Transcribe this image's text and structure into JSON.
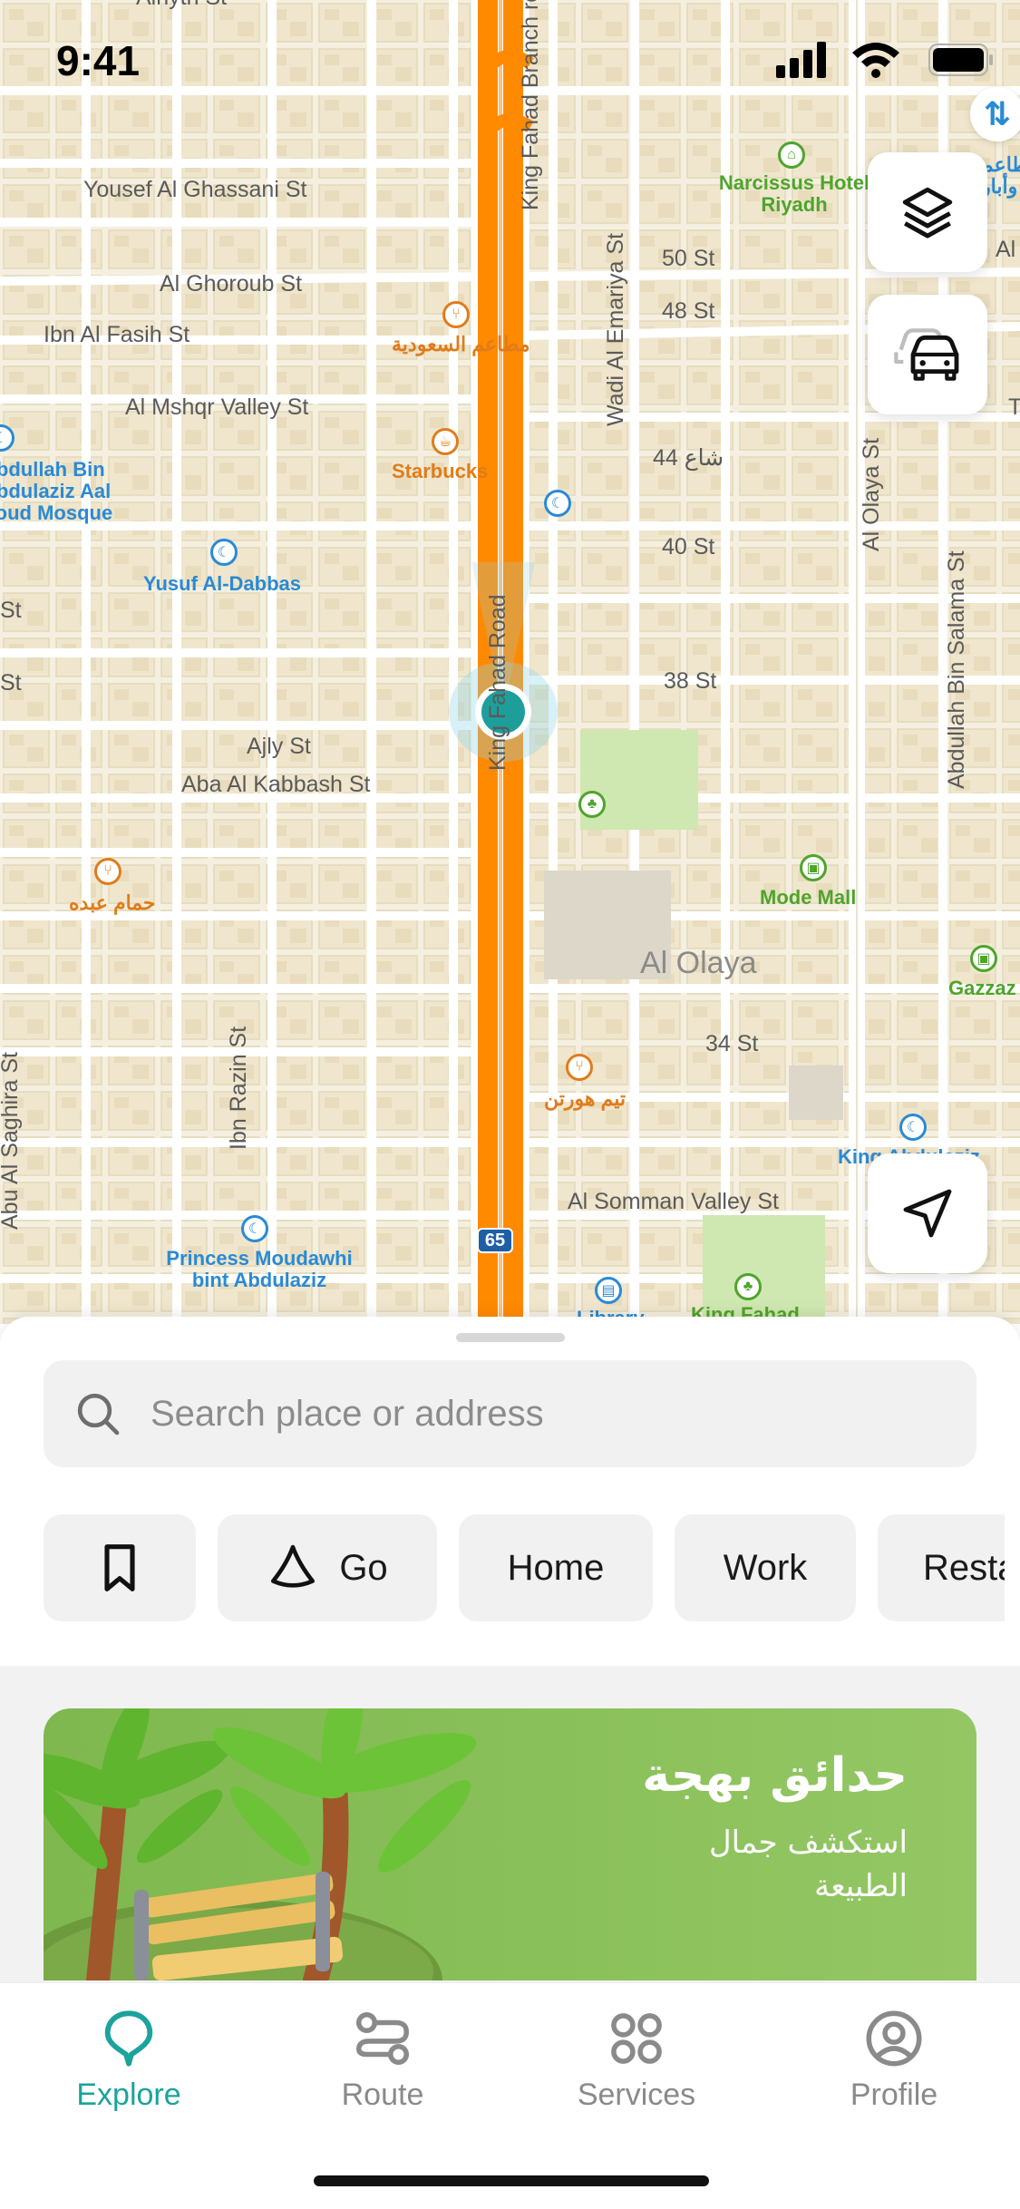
{
  "status_bar": {
    "time": "9:41"
  },
  "map": {
    "streets": {
      "yousef": "Yousef Al Ghassani St",
      "ghoroub": "Al Ghoroub St",
      "fasih": "Ibn Al Fasih St",
      "mshqr": "Al Mshqr Valley St",
      "st50": "50 St",
      "st48": "48 St",
      "st44": "44 شاع",
      "st40": "40 St",
      "st38": "38 St",
      "st34": "34 St",
      "ajly": "Ajly St",
      "kabbash": "Aba Al Kabbash St",
      "somman": "Al Somman Valley St",
      "king_fahad_road": "King Fahad Road",
      "king_fahad_branch": "King Fahad Branch ro",
      "wadi_emariya": "Wadi Al Emariya St",
      "olaya_st": "Al Olaya St",
      "bin_salama": "Abdullah Bin Salama St",
      "razin": "Ibn Razin St",
      "saghira": "Abu Al Saghira St",
      "alnyth": "Alnyth St",
      "st_left1": "St",
      "st_left2": "St",
      "al_right": "Al",
      "t_right": "T"
    },
    "district": "Al Olaya",
    "pois": {
      "narcissus": "Narcissus Hotel Riyadh",
      "saudi_restaurant": "مطاعم السعودية",
      "starbucks": "Starbucks",
      "mosque": "Abdullah Bin Abdulaziz Aal Soud Mosque",
      "yusuf": "Yusuf Al-Dabbas",
      "hamam": "حمام عبده",
      "mode_mall": "Mode Mall",
      "gazzaz": "Gazzaz",
      "tim_hortons": "تيم هورتن",
      "king_abdulaziz": "King Abdulaziz",
      "princess": "Princess Moudawhi bint Abdulaziz",
      "library": "Library",
      "king_fahad_park": "King Fahad",
      "road_shield": "65",
      "arabic_corner": "مطاعم وأبار"
    }
  },
  "search": {
    "placeholder": "Search place or address"
  },
  "chips": {
    "go": "Go",
    "home": "Home",
    "work": "Work",
    "restaurants": "Resta"
  },
  "promo": {
    "title": "حدائق بهجة",
    "subtitle": "استكشف جمال الطبيعة"
  },
  "tabs": {
    "explore": "Explore",
    "route": "Route",
    "services": "Services",
    "profile": "Profile"
  },
  "colors": {
    "accent": "#1ba39c",
    "road": "#ff8a00",
    "map_bg": "#f4efdf",
    "promo": "#8bc25a"
  }
}
